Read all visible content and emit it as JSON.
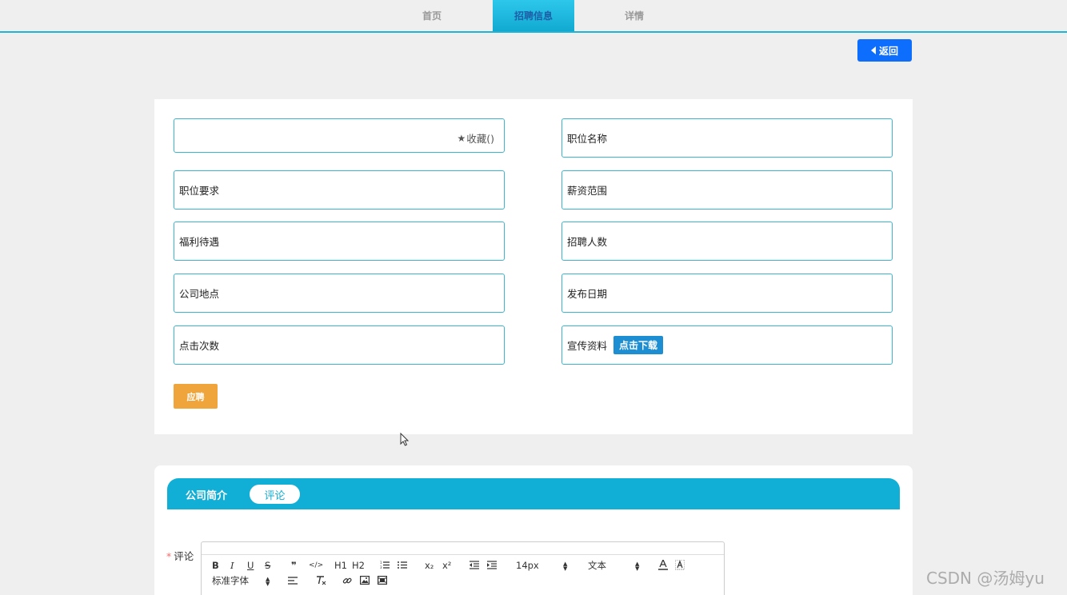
{
  "nav": {
    "tabs": [
      {
        "label": "首页",
        "active": false
      },
      {
        "label": "招聘信息",
        "active": true
      },
      {
        "label": "详情",
        "active": false
      }
    ]
  },
  "back_button": {
    "label": "返回",
    "icon": "caret-left-icon"
  },
  "favorite": {
    "label": "收藏()",
    "icon": "star-icon"
  },
  "fields": {
    "job_title": "职位名称",
    "job_requirements": "职位要求",
    "salary_range": "薪资范围",
    "benefits": "福利待遇",
    "headcount": "招聘人数",
    "company_location": "公司地点",
    "publish_date": "发布日期",
    "click_count": "点击次数",
    "promo_materials": "宣传资料",
    "download_label": "点击下载"
  },
  "apply_button": {
    "label": "应聘"
  },
  "detail_tabs": [
    {
      "label": "公司简介",
      "active": false
    },
    {
      "label": "评论",
      "active": true
    }
  ],
  "comment": {
    "label": "评论",
    "required_mark": "*"
  },
  "editor_toolbar": {
    "row1": [
      "B",
      "I",
      "U",
      "S",
      "❞",
      "</>",
      "H1",
      "H2",
      "ol",
      "ul",
      "x₂",
      "x²",
      "outdent",
      "indent"
    ],
    "size_select": "14px",
    "header_select": "文本",
    "font_select": "标准字体"
  },
  "watermark": "CSDN @汤姆yu",
  "colors": {
    "accent": "#11aed6",
    "primary_button": "#0d6efd",
    "apply_button": "#f0a53c",
    "download_button": "#1d8ed1",
    "field_border": "#3bb4cf"
  }
}
